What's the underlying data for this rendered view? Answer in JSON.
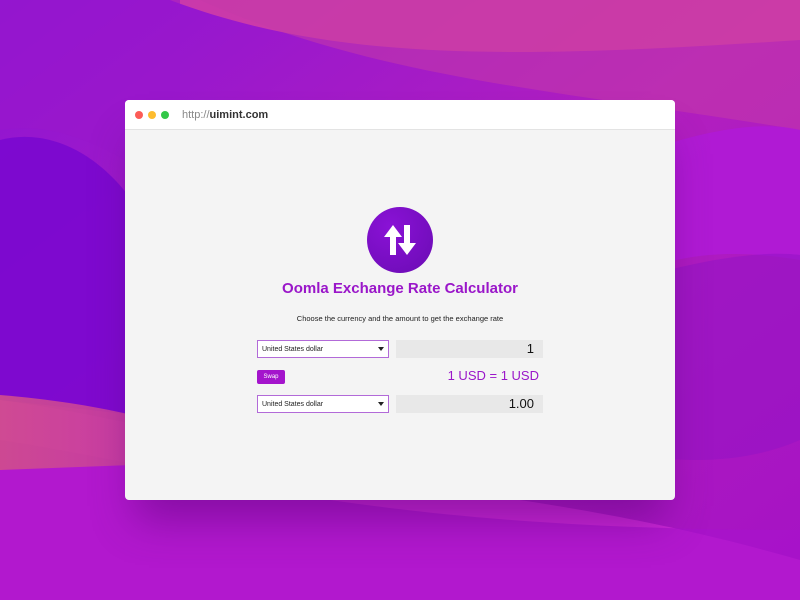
{
  "browser": {
    "url_scheme": "http://",
    "url_host": "uimint.com"
  },
  "app": {
    "title": "Oomla Exchange Rate Calculator",
    "subtitle": "Choose the currency and the amount to get the exchange rate",
    "logo_icon": "swap-arrows-icon",
    "accent_color": "#9a16c9"
  },
  "converter": {
    "from_currency": "United States dollar",
    "from_amount": "1",
    "swap_label": "Swap",
    "rate_text": "1 USD = 1 USD",
    "to_currency": "United States dollar",
    "to_amount": "1.00"
  }
}
